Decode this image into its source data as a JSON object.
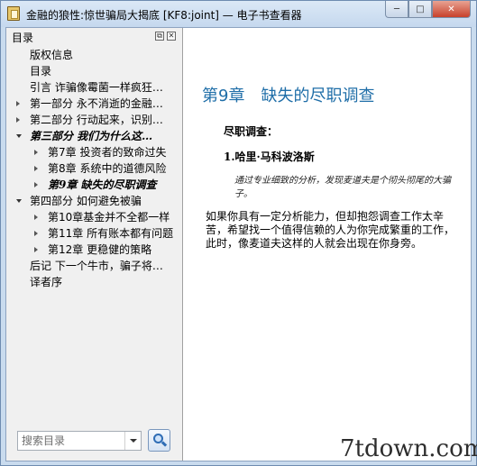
{
  "window": {
    "title": "金融的狼性:惊世骗局大揭底 [KF8:joint] — 电子书查看器",
    "buttons": {
      "minimize": "─",
      "maximize": "□",
      "close": "✕"
    }
  },
  "sidebar": {
    "title": "目录",
    "items": [
      {
        "label": "版权信息",
        "indent": 0,
        "arrow": "none",
        "style": "normal"
      },
      {
        "label": "目录",
        "indent": 0,
        "arrow": "none",
        "style": "normal"
      },
      {
        "label": "引言 诈骗像霉菌一样疯狂…",
        "indent": 0,
        "arrow": "none",
        "style": "normal"
      },
      {
        "label": "第一部分 永不消逝的金融…",
        "indent": 0,
        "arrow": "right",
        "style": "normal"
      },
      {
        "label": "第二部分 行动起来，识别…",
        "indent": 0,
        "arrow": "right",
        "style": "normal"
      },
      {
        "label": "第三部分 我们为什么这…",
        "indent": 0,
        "arrow": "down",
        "style": "bold-italic"
      },
      {
        "label": "第7章 投资者的致命过失",
        "indent": 1,
        "arrow": "right",
        "style": "normal"
      },
      {
        "label": "第8章 系统中的道德风险",
        "indent": 1,
        "arrow": "right",
        "style": "normal"
      },
      {
        "label": "第9章 缺失的尽职调查",
        "indent": 1,
        "arrow": "right",
        "style": "bold-italic"
      },
      {
        "label": "第四部分 如何避免被骗",
        "indent": 0,
        "arrow": "down",
        "style": "normal"
      },
      {
        "label": "第10章基金并不全都一样",
        "indent": 1,
        "arrow": "right",
        "style": "normal"
      },
      {
        "label": "第11章 所有账本都有问题",
        "indent": 1,
        "arrow": "right",
        "style": "normal"
      },
      {
        "label": "第12章 更稳健的策略",
        "indent": 1,
        "arrow": "right",
        "style": "normal"
      },
      {
        "label": "后记 下一个牛市，骗子将…",
        "indent": 0,
        "arrow": "none",
        "style": "normal"
      },
      {
        "label": "译者序",
        "indent": 0,
        "arrow": "none",
        "style": "normal"
      }
    ],
    "search": {
      "placeholder": "搜索目录"
    }
  },
  "content": {
    "chapter_title": "第9章　缺失的尽职调查",
    "section_title": "尽职调查：",
    "subsection_title": "1.哈里·马科波洛斯",
    "quote": "通过专业细致的分析，发现麦道夫是个彻头彻尾的大骗子。",
    "body": "如果你具有一定分析能力，但却抱怨调查工作太辛苦，希望找一个值得信赖的人为你完成繁重的工作，此时，像麦道夫这样的人就会出现在你身旁。"
  },
  "watermark": "7tdown.com"
}
